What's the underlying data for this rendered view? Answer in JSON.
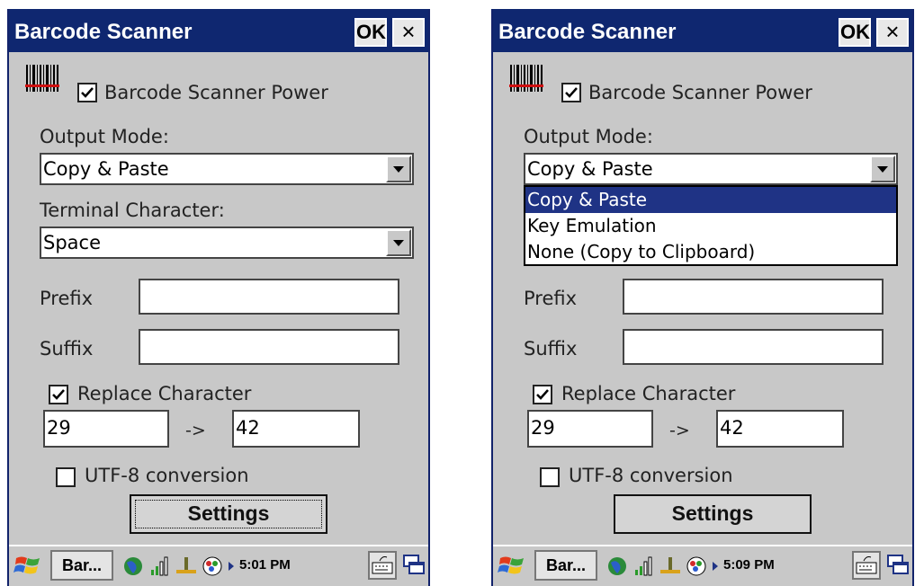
{
  "screens": [
    {
      "title": "Barcode Scanner",
      "ok_label": "OK",
      "close_label": "×",
      "power_label": "Barcode Scanner Power",
      "power_checked": true,
      "output_mode_label": "Output Mode:",
      "output_mode_value": "Copy & Paste",
      "terminal_label": "Terminal Character:",
      "terminal_value": "Space",
      "prefix_label": "Prefix",
      "prefix_value": "",
      "suffix_label": "Suffix",
      "suffix_value": "",
      "replace_label": "Replace Character",
      "replace_checked": true,
      "replace_from": "29",
      "arrow_label": "->",
      "replace_to": "42",
      "utf8_label": "UTF-8 conversion",
      "utf8_checked": false,
      "settings_label": "Settings",
      "taskbar_item": "Bar...",
      "clock": "5:01 PM",
      "dropdown_open": false
    },
    {
      "title": "Barcode Scanner",
      "ok_label": "OK",
      "close_label": "×",
      "power_label": "Barcode Scanner Power",
      "power_checked": true,
      "output_mode_label": "Output Mode:",
      "output_mode_value": "Copy & Paste",
      "dropdown_options": [
        "Copy & Paste",
        "Key Emulation",
        "None (Copy to Clipboard)"
      ],
      "dropdown_selected_index": 0,
      "prefix_label": "Prefix",
      "prefix_value": "",
      "suffix_label": "Suffix",
      "suffix_value": "",
      "replace_label": "Replace Character",
      "replace_checked": true,
      "replace_from": "29",
      "arrow_label": "->",
      "replace_to": "42",
      "utf8_label": "UTF-8 conversion",
      "utf8_checked": false,
      "settings_label": "Settings",
      "taskbar_item": "Bar...",
      "clock": "5:09 PM",
      "dropdown_open": true
    }
  ],
  "colors": {
    "titlebar": "#0f2770",
    "window_bg": "#c8c8c8",
    "selection": "#1f3385"
  }
}
